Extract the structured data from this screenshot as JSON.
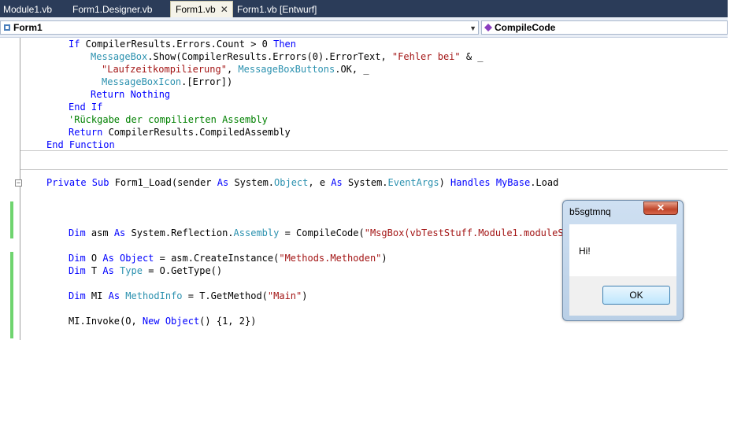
{
  "tabs": [
    {
      "label": "Module1.vb",
      "active": false
    },
    {
      "label": "Form1.Designer.vb",
      "active": false
    },
    {
      "label": "Form1.vb",
      "active": true
    },
    {
      "label": "Form1.vb [Entwurf]",
      "active": false
    }
  ],
  "tab_close_glyph": "✕",
  "navbar": {
    "class_combo": "Form1",
    "method_combo": "CompileCode"
  },
  "code_lines": [
    [
      {
        "t": "If",
        "c": "kw"
      },
      {
        "t": " CompilerResults.Errors.Count > 0 ",
        "c": "tx"
      },
      {
        "t": "Then",
        "c": "kw"
      }
    ],
    [
      {
        "t": "MessageBox",
        "c": "ty"
      },
      {
        "t": ".Show(CompilerResults.Errors(0).ErrorText, ",
        "c": "tx"
      },
      {
        "t": "\"Fehler bei\"",
        "c": "st"
      },
      {
        "t": " & _",
        "c": "tx"
      }
    ],
    [
      {
        "t": "\"Laufzeitkompilierung\"",
        "c": "st"
      },
      {
        "t": ", ",
        "c": "tx"
      },
      {
        "t": "MessageBoxButtons",
        "c": "ty"
      },
      {
        "t": ".OK, _",
        "c": "tx"
      }
    ],
    [
      {
        "t": "MessageBoxIcon",
        "c": "ty"
      },
      {
        "t": ".[Error])",
        "c": "tx"
      }
    ],
    [
      {
        "t": "Return Nothing",
        "c": "kw"
      }
    ],
    [
      {
        "t": "End If",
        "c": "kw"
      }
    ],
    [
      {
        "t": "'Rückgabe der compilierten Assembly",
        "c": "cm"
      }
    ],
    [
      {
        "t": "Return",
        "c": "kw"
      },
      {
        "t": " CompilerResults.CompiledAssembly",
        "c": "tx"
      }
    ],
    [
      {
        "t": "End Function",
        "c": "kw"
      }
    ],
    [
      {
        "t": "Private Sub",
        "c": "kw"
      },
      {
        "t": " Form1_Load(sender ",
        "c": "tx"
      },
      {
        "t": "As",
        "c": "kw"
      },
      {
        "t": " System.",
        "c": "tx"
      },
      {
        "t": "Object",
        "c": "ty"
      },
      {
        "t": ", e ",
        "c": "tx"
      },
      {
        "t": "As",
        "c": "kw"
      },
      {
        "t": " System.",
        "c": "tx"
      },
      {
        "t": "EventArgs",
        "c": "ty"
      },
      {
        "t": ") ",
        "c": "tx"
      },
      {
        "t": "Handles",
        "c": "kw"
      },
      {
        "t": " ",
        "c": "tx"
      },
      {
        "t": "MyBase",
        "c": "kw"
      },
      {
        "t": ".Load",
        "c": "tx"
      }
    ],
    [
      {
        "t": "Dim",
        "c": "kw"
      },
      {
        "t": " asm ",
        "c": "tx"
      },
      {
        "t": "As",
        "c": "kw"
      },
      {
        "t": " System.Reflection.",
        "c": "tx"
      },
      {
        "t": "Assembly",
        "c": "ty"
      },
      {
        "t": " = CompileCode(",
        "c": "tx"
      },
      {
        "t": "\"MsgBox(vbTestStuff.Module1.moduleStri",
        "c": "st"
      }
    ],
    [
      {
        "t": "Dim",
        "c": "kw"
      },
      {
        "t": " O ",
        "c": "tx"
      },
      {
        "t": "As Object",
        "c": "kw"
      },
      {
        "t": " = asm.CreateInstance(",
        "c": "tx"
      },
      {
        "t": "\"Methods.Methoden\"",
        "c": "st"
      },
      {
        "t": ")",
        "c": "tx"
      }
    ],
    [
      {
        "t": "Dim",
        "c": "kw"
      },
      {
        "t": " T ",
        "c": "tx"
      },
      {
        "t": "As",
        "c": "kw"
      },
      {
        "t": " ",
        "c": "tx"
      },
      {
        "t": "Type",
        "c": "ty"
      },
      {
        "t": " = O.GetType()",
        "c": "tx"
      }
    ],
    [
      {
        "t": "Dim",
        "c": "kw"
      },
      {
        "t": " MI ",
        "c": "tx"
      },
      {
        "t": "As",
        "c": "kw"
      },
      {
        "t": " ",
        "c": "tx"
      },
      {
        "t": "MethodInfo",
        "c": "ty"
      },
      {
        "t": " = T.GetMethod(",
        "c": "tx"
      },
      {
        "t": "\"Main\"",
        "c": "st"
      },
      {
        "t": ")",
        "c": "tx"
      }
    ],
    [
      {
        "t": "MI.Invoke(O, ",
        "c": "tx"
      },
      {
        "t": "New Object",
        "c": "kw"
      },
      {
        "t": "() {1, 2})",
        "c": "tx"
      }
    ]
  ],
  "messagebox": {
    "title": "b5sgtmnq",
    "close_glyph": "✕",
    "message": "Hi!",
    "ok_label": "OK"
  }
}
